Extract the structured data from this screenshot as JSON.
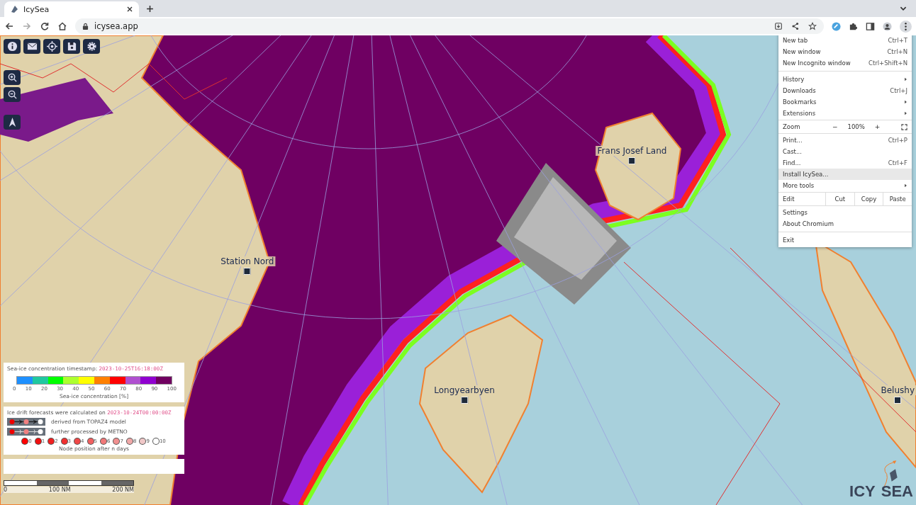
{
  "browser": {
    "tab_title": "IcySea",
    "url": "icysea.app"
  },
  "map_labels": [
    {
      "text": "Station Nord"
    },
    {
      "text": "Frans Josef Land"
    },
    {
      "text": "Longyearbyen"
    },
    {
      "text": "Belushy"
    }
  ],
  "menu": [
    {
      "kind": "item",
      "label": "New tab",
      "shortcut": "Ctrl+T",
      "submenu": false,
      "selected": false
    },
    {
      "kind": "item",
      "label": "New window",
      "shortcut": "Ctrl+N",
      "submenu": false,
      "selected": false
    },
    {
      "kind": "item",
      "label": "New Incognito window",
      "shortcut": "Ctrl+Shift+N",
      "submenu": false,
      "selected": false
    },
    {
      "kind": "separator"
    },
    {
      "kind": "item",
      "label": "History",
      "submenu": true,
      "selected": false
    },
    {
      "kind": "item",
      "label": "Downloads",
      "shortcut": "Ctrl+J",
      "submenu": false,
      "selected": false
    },
    {
      "kind": "item",
      "label": "Bookmarks",
      "submenu": true,
      "selected": false
    },
    {
      "kind": "item",
      "label": "Extensions",
      "submenu": true,
      "selected": false
    },
    {
      "kind": "zoom",
      "label": "Zoom",
      "minus": "−",
      "value": "100%",
      "plus": "+"
    },
    {
      "kind": "item",
      "label": "Print...",
      "shortcut": "Ctrl+P",
      "submenu": false,
      "selected": false
    },
    {
      "kind": "item",
      "label": "Cast...",
      "submenu": false,
      "selected": false
    },
    {
      "kind": "item",
      "label": "Find...",
      "shortcut": "Ctrl+F",
      "submenu": false,
      "selected": false
    },
    {
      "kind": "item",
      "label": "Install IcySea...",
      "submenu": false,
      "selected": true
    },
    {
      "kind": "item",
      "label": "More tools",
      "submenu": true,
      "selected": false
    },
    {
      "kind": "edit",
      "label": "Edit",
      "actions": [
        "Cut",
        "Copy",
        "Paste"
      ]
    },
    {
      "kind": "item",
      "label": "Settings",
      "submenu": false,
      "selected": false
    },
    {
      "kind": "item",
      "label": "About Chromium",
      "submenu": false,
      "selected": false
    },
    {
      "kind": "separator"
    },
    {
      "kind": "item",
      "label": "Exit",
      "submenu": false,
      "selected": false
    }
  ],
  "concentration_legend": {
    "label": "Sea-ice concentration timestamp:",
    "timestamp": "2023-10-25T16:18:00Z",
    "segments": [
      {
        "color": "#1e90ff"
      },
      {
        "color": "#20c8a0"
      },
      {
        "color": "#00ff00"
      },
      {
        "color": "#adff2f"
      },
      {
        "color": "#ffff00"
      },
      {
        "color": "#ff8000"
      },
      {
        "color": "#ff0000"
      },
      {
        "color": "#b050d0"
      },
      {
        "color": "#9000d0"
      },
      {
        "color": "#700060"
      }
    ],
    "ticks": [
      "0",
      "10",
      "20",
      "30",
      "40",
      "50",
      "60",
      "70",
      "80",
      "90",
      "100"
    ],
    "axis_label": "Sea-ice concentration [%]"
  },
  "drift_legend": {
    "label": "Ice drift forecasts were calculated on",
    "timestamp": "2023-10-24T00:00:00Z",
    "sources": [
      {
        "kind": "arrow",
        "text": "derived from TOPAZ4 model"
      },
      {
        "kind": "bracket",
        "text": "further processed by METNO"
      }
    ],
    "nodes": [
      {
        "label": "0",
        "color": "#ff0000"
      },
      {
        "label": "1",
        "color": "#f01010"
      },
      {
        "label": "2",
        "color": "#f02020"
      },
      {
        "label": "3",
        "color": "#f03030"
      },
      {
        "label": "4",
        "color": "#f04848"
      },
      {
        "label": "5",
        "color": "#f06060"
      },
      {
        "label": "6",
        "color": "#f07878"
      },
      {
        "label": "7",
        "color": "#f09090"
      },
      {
        "label": "8",
        "color": "#f0a8a8"
      },
      {
        "label": "9",
        "color": "#f0c8c8"
      },
      {
        "label": "10",
        "color": "#ffffff"
      }
    ],
    "caption": "Node position after n days"
  },
  "scale_bar": {
    "labels": [
      "0",
      "100 NM",
      "200 NM"
    ]
  },
  "logo": {
    "left": "ICY",
    "right": "SEA"
  }
}
